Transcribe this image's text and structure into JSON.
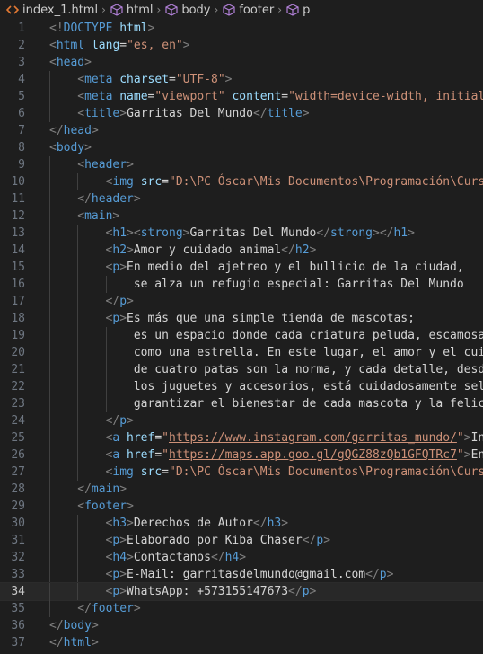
{
  "breadcrumb": {
    "items": [
      {
        "label": "index_1.html",
        "icon": "html-file-icon"
      },
      {
        "label": "html",
        "icon": "element-cube-icon"
      },
      {
        "label": "body",
        "icon": "element-cube-icon"
      },
      {
        "label": "footer",
        "icon": "element-cube-icon"
      },
      {
        "label": "p",
        "icon": "element-cube-icon"
      }
    ]
  },
  "editor": {
    "active_line": 34,
    "colors": {
      "background": "#1e1e1e",
      "tag": "#569cd6",
      "attribute": "#9cdcfe",
      "string": "#ce9178",
      "text": "#d4d4d4",
      "bracket": "#808080"
    },
    "lines": [
      {
        "n": "1",
        "indent": 0,
        "tokens": [
          [
            "b",
            "<!"
          ],
          [
            "t",
            "DOCTYPE"
          ],
          [
            "x",
            " "
          ],
          [
            "a",
            "html"
          ],
          [
            "b",
            ">"
          ]
        ]
      },
      {
        "n": "2",
        "indent": 0,
        "tokens": [
          [
            "b",
            "<"
          ],
          [
            "t",
            "html"
          ],
          [
            "x",
            " "
          ],
          [
            "a",
            "lang"
          ],
          [
            "x",
            "="
          ],
          [
            "s",
            "\"es, en\""
          ],
          [
            "b",
            ">"
          ]
        ]
      },
      {
        "n": "3",
        "indent": 0,
        "tokens": [
          [
            "b",
            "<"
          ],
          [
            "t",
            "head"
          ],
          [
            "b",
            ">"
          ]
        ]
      },
      {
        "n": "4",
        "indent": 1,
        "tokens": [
          [
            "b",
            "<"
          ],
          [
            "t",
            "meta"
          ],
          [
            "x",
            " "
          ],
          [
            "a",
            "charset"
          ],
          [
            "x",
            "="
          ],
          [
            "s",
            "\"UTF-8\""
          ],
          [
            "b",
            ">"
          ]
        ]
      },
      {
        "n": "5",
        "indent": 1,
        "tokens": [
          [
            "b",
            "<"
          ],
          [
            "t",
            "meta"
          ],
          [
            "x",
            " "
          ],
          [
            "a",
            "name"
          ],
          [
            "x",
            "="
          ],
          [
            "s",
            "\"viewport\""
          ],
          [
            "x",
            " "
          ],
          [
            "a",
            "content"
          ],
          [
            "x",
            "="
          ],
          [
            "s",
            "\"width=device-width, initial-"
          ]
        ]
      },
      {
        "n": "6",
        "indent": 1,
        "tokens": [
          [
            "b",
            "<"
          ],
          [
            "t",
            "title"
          ],
          [
            "b",
            ">"
          ],
          [
            "x",
            "Garritas Del Mundo"
          ],
          [
            "b",
            "</"
          ],
          [
            "t",
            "title"
          ],
          [
            "b",
            ">"
          ]
        ]
      },
      {
        "n": "7",
        "indent": 0,
        "tokens": [
          [
            "b",
            "</"
          ],
          [
            "t",
            "head"
          ],
          [
            "b",
            ">"
          ]
        ]
      },
      {
        "n": "8",
        "indent": 0,
        "tokens": [
          [
            "b",
            "<"
          ],
          [
            "t",
            "body"
          ],
          [
            "b",
            ">"
          ]
        ]
      },
      {
        "n": "9",
        "indent": 1,
        "tokens": [
          [
            "b",
            "<"
          ],
          [
            "t",
            "header"
          ],
          [
            "b",
            ">"
          ]
        ]
      },
      {
        "n": "10",
        "indent": 2,
        "tokens": [
          [
            "b",
            "<"
          ],
          [
            "t",
            "img"
          ],
          [
            "x",
            " "
          ],
          [
            "a",
            "src"
          ],
          [
            "x",
            "="
          ],
          [
            "s",
            "\"D:\\PC Óscar\\Mis Documentos\\Programación\\Curso"
          ]
        ]
      },
      {
        "n": "11",
        "indent": 1,
        "tokens": [
          [
            "b",
            "</"
          ],
          [
            "t",
            "header"
          ],
          [
            "b",
            ">"
          ]
        ]
      },
      {
        "n": "12",
        "indent": 1,
        "tokens": [
          [
            "b",
            "<"
          ],
          [
            "t",
            "main"
          ],
          [
            "b",
            ">"
          ]
        ]
      },
      {
        "n": "13",
        "indent": 2,
        "tokens": [
          [
            "b",
            "<"
          ],
          [
            "t",
            "h1"
          ],
          [
            "b",
            "><"
          ],
          [
            "t",
            "strong"
          ],
          [
            "b",
            ">"
          ],
          [
            "x",
            "Garritas Del Mundo"
          ],
          [
            "b",
            "</"
          ],
          [
            "t",
            "strong"
          ],
          [
            "b",
            "></"
          ],
          [
            "t",
            "h1"
          ],
          [
            "b",
            ">"
          ]
        ]
      },
      {
        "n": "14",
        "indent": 2,
        "tokens": [
          [
            "b",
            "<"
          ],
          [
            "t",
            "h2"
          ],
          [
            "b",
            ">"
          ],
          [
            "x",
            "Amor y cuidado animal"
          ],
          [
            "b",
            "</"
          ],
          [
            "t",
            "h2"
          ],
          [
            "b",
            ">"
          ]
        ]
      },
      {
        "n": "15",
        "indent": 2,
        "tokens": [
          [
            "b",
            "<"
          ],
          [
            "t",
            "p"
          ],
          [
            "b",
            ">"
          ],
          [
            "x",
            "En medio del ajetreo y el bullicio de la ciudad,"
          ]
        ]
      },
      {
        "n": "16",
        "indent": 3,
        "tokens": [
          [
            "x",
            "se alza un refugio especial: Garritas Del Mundo"
          ]
        ]
      },
      {
        "n": "17",
        "indent": 2,
        "tokens": [
          [
            "b",
            "</"
          ],
          [
            "t",
            "p"
          ],
          [
            "b",
            ">"
          ]
        ]
      },
      {
        "n": "18",
        "indent": 2,
        "tokens": [
          [
            "b",
            "<"
          ],
          [
            "t",
            "p"
          ],
          [
            "b",
            ">"
          ],
          [
            "x",
            "Es más que una simple tienda de mascotas;"
          ]
        ]
      },
      {
        "n": "19",
        "indent": 3,
        "tokens": [
          [
            "x",
            "es un espacio donde cada criatura peluda, escamosa"
          ]
        ]
      },
      {
        "n": "20",
        "indent": 3,
        "tokens": [
          [
            "x",
            "como una estrella. En este lugar, el amor y el cuid"
          ]
        ]
      },
      {
        "n": "21",
        "indent": 3,
        "tokens": [
          [
            "x",
            "de cuatro patas son la norma, y cada detalle, desde"
          ]
        ]
      },
      {
        "n": "22",
        "indent": 3,
        "tokens": [
          [
            "x",
            "los juguetes y accesorios, está cuidadosamente sele"
          ]
        ]
      },
      {
        "n": "23",
        "indent": 3,
        "tokens": [
          [
            "x",
            "garantizar el bienestar de cada mascota y la felici"
          ]
        ]
      },
      {
        "n": "24",
        "indent": 2,
        "tokens": [
          [
            "b",
            "</"
          ],
          [
            "t",
            "p"
          ],
          [
            "b",
            ">"
          ]
        ]
      },
      {
        "n": "25",
        "indent": 2,
        "tokens": [
          [
            "b",
            "<"
          ],
          [
            "t",
            "a"
          ],
          [
            "x",
            " "
          ],
          [
            "a",
            "href"
          ],
          [
            "x",
            "="
          ],
          [
            "s",
            "\""
          ],
          [
            "l",
            "https://www.instagram.com/garritas_mundo/"
          ],
          [
            "s",
            "\""
          ],
          [
            "b",
            ">"
          ],
          [
            "x",
            "Ins"
          ]
        ]
      },
      {
        "n": "26",
        "indent": 2,
        "tokens": [
          [
            "b",
            "<"
          ],
          [
            "t",
            "a"
          ],
          [
            "x",
            " "
          ],
          [
            "a",
            "href"
          ],
          [
            "x",
            "="
          ],
          [
            "s",
            "\""
          ],
          [
            "l",
            "https://maps.app.goo.gl/gQGZ88zQb1GFQTRc7"
          ],
          [
            "s",
            "\""
          ],
          [
            "b",
            ">"
          ],
          [
            "x",
            "Enc"
          ]
        ]
      },
      {
        "n": "27",
        "indent": 2,
        "tokens": [
          [
            "b",
            "<"
          ],
          [
            "t",
            "img"
          ],
          [
            "x",
            " "
          ],
          [
            "a",
            "src"
          ],
          [
            "x",
            "="
          ],
          [
            "s",
            "\"D:\\PC Óscar\\Mis Documentos\\Programación\\Curso"
          ]
        ]
      },
      {
        "n": "28",
        "indent": 1,
        "tokens": [
          [
            "b",
            "</"
          ],
          [
            "t",
            "main"
          ],
          [
            "b",
            ">"
          ]
        ]
      },
      {
        "n": "29",
        "indent": 1,
        "tokens": [
          [
            "b",
            "<"
          ],
          [
            "t",
            "footer"
          ],
          [
            "b",
            ">"
          ]
        ]
      },
      {
        "n": "30",
        "indent": 2,
        "tokens": [
          [
            "b",
            "<"
          ],
          [
            "t",
            "h3"
          ],
          [
            "b",
            ">"
          ],
          [
            "x",
            "Derechos de Autor"
          ],
          [
            "b",
            "</"
          ],
          [
            "t",
            "h3"
          ],
          [
            "b",
            ">"
          ]
        ]
      },
      {
        "n": "31",
        "indent": 2,
        "tokens": [
          [
            "b",
            "<"
          ],
          [
            "t",
            "p"
          ],
          [
            "b",
            ">"
          ],
          [
            "x",
            "Elaborado por Kiba Chaser"
          ],
          [
            "b",
            "</"
          ],
          [
            "t",
            "p"
          ],
          [
            "b",
            ">"
          ]
        ]
      },
      {
        "n": "32",
        "indent": 2,
        "tokens": [
          [
            "b",
            "<"
          ],
          [
            "t",
            "h4"
          ],
          [
            "b",
            ">"
          ],
          [
            "x",
            "Contactanos"
          ],
          [
            "b",
            "</"
          ],
          [
            "t",
            "h4"
          ],
          [
            "b",
            ">"
          ]
        ]
      },
      {
        "n": "33",
        "indent": 2,
        "tokens": [
          [
            "b",
            "<"
          ],
          [
            "t",
            "p"
          ],
          [
            "b",
            ">"
          ],
          [
            "x",
            "E-Mail: garritasdelmundo@gmail.com"
          ],
          [
            "b",
            "</"
          ],
          [
            "t",
            "p"
          ],
          [
            "b",
            ">"
          ]
        ]
      },
      {
        "n": "34",
        "indent": 2,
        "tokens": [
          [
            "b",
            "<"
          ],
          [
            "t",
            "p"
          ],
          [
            "b",
            ">"
          ],
          [
            "x",
            "WhatsApp: +573155147673"
          ],
          [
            "b",
            "</"
          ],
          [
            "t",
            "p"
          ],
          [
            "b",
            ">"
          ]
        ]
      },
      {
        "n": "35",
        "indent": 1,
        "tokens": [
          [
            "b",
            "</"
          ],
          [
            "t",
            "footer"
          ],
          [
            "b",
            ">"
          ]
        ]
      },
      {
        "n": "36",
        "indent": 0,
        "tokens": [
          [
            "b",
            "</"
          ],
          [
            "t",
            "body"
          ],
          [
            "b",
            ">"
          ]
        ]
      },
      {
        "n": "37",
        "indent": 0,
        "tokens": [
          [
            "b",
            "</"
          ],
          [
            "t",
            "html"
          ],
          [
            "b",
            ">"
          ]
        ]
      }
    ]
  }
}
